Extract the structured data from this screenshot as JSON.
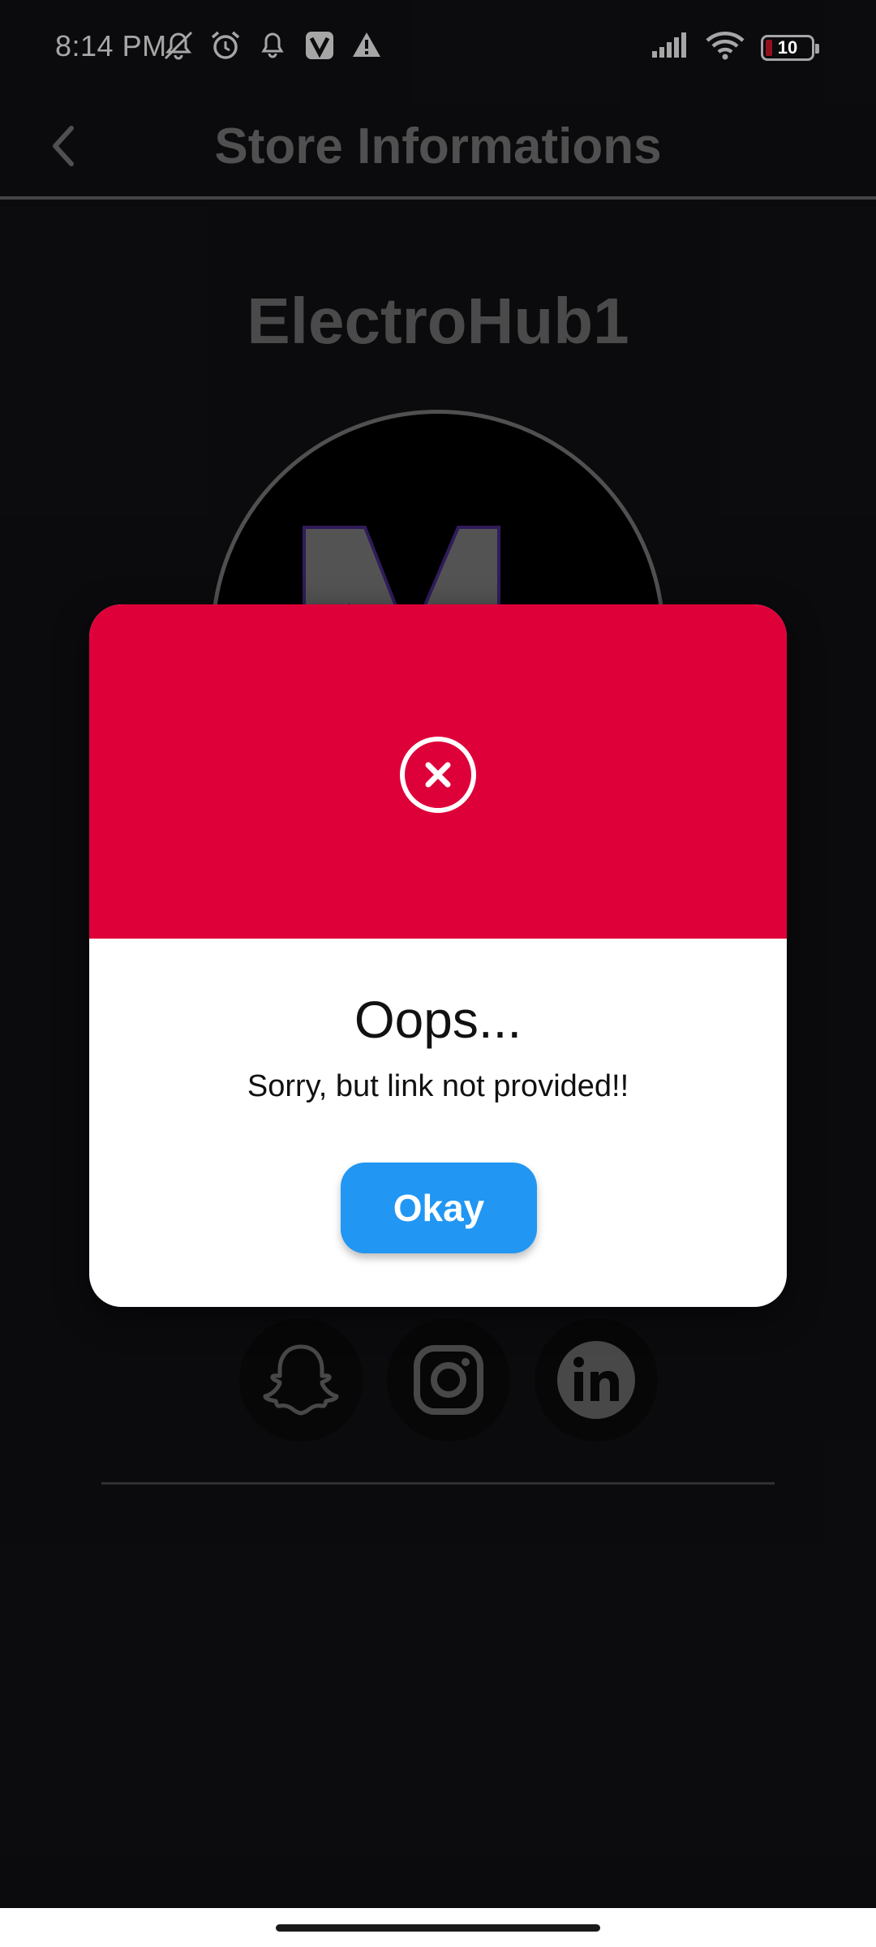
{
  "status_bar": {
    "time": "8:14 PM",
    "left_icons": [
      "mute-icon",
      "alarm-icon",
      "notification-bell-icon",
      "v-app-icon",
      "warning-icon"
    ],
    "right_icons": [
      "signal-icon",
      "wifi-icon",
      "battery-icon"
    ],
    "battery_level": "10"
  },
  "app_bar": {
    "back_icon": "chevron-left-icon",
    "title": "Store Informations"
  },
  "store": {
    "name": "ElectroHub1"
  },
  "social_links": [
    {
      "icon": "snapchat-icon"
    },
    {
      "icon": "instagram-icon"
    },
    {
      "icon": "linkedin-icon"
    }
  ],
  "dialog": {
    "icon": "close-circle-icon",
    "title": "Oops...",
    "message": "Sorry, but link not provided!!",
    "button_label": "Okay"
  },
  "colors": {
    "background": "#121116",
    "dialog_header": "#de0039",
    "button": "#2196f3",
    "muted_text": "#7c7c7c"
  }
}
